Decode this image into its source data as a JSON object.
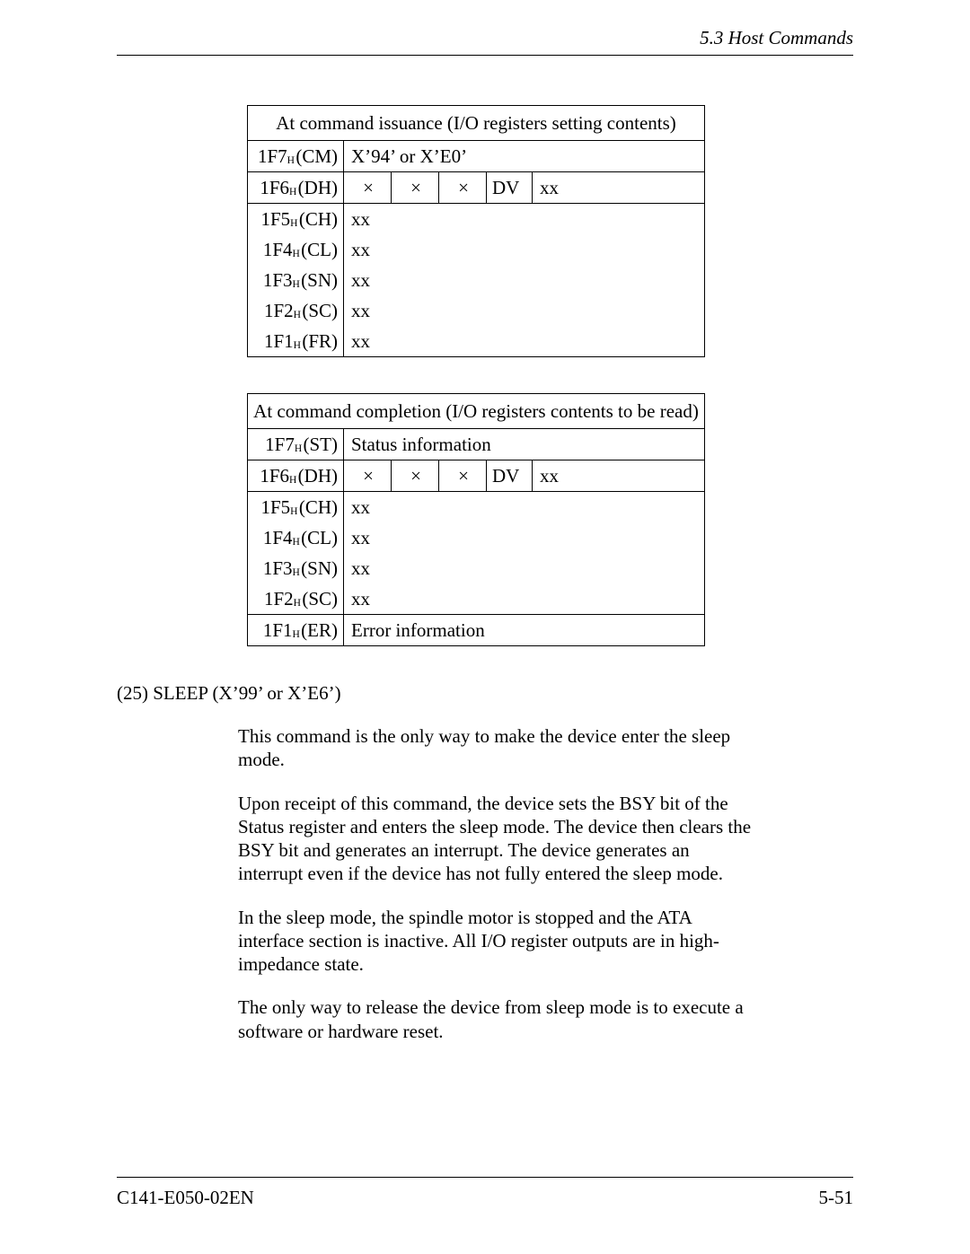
{
  "header": {
    "section": "5.3  Host Commands"
  },
  "tables": {
    "issuance": {
      "caption": "At command issuance (I/O registers setting contents)",
      "rows": [
        {
          "reg": "1F7",
          "sub": "H",
          "name": "CM",
          "full": "X’94’ or X’E0’"
        },
        {
          "reg": "1F6",
          "sub": "H",
          "name": "DH",
          "bits": [
            "×",
            "×",
            "×",
            "DV",
            "xx"
          ]
        },
        {
          "reg": "1F5",
          "sub": "H",
          "name": "CH",
          "full": "xx"
        },
        {
          "reg": "1F4",
          "sub": "H",
          "name": "CL",
          "full": "xx"
        },
        {
          "reg": "1F3",
          "sub": "H",
          "name": "SN",
          "full": "xx"
        },
        {
          "reg": "1F2",
          "sub": "H",
          "name": "SC",
          "full": "xx"
        },
        {
          "reg": "1F1",
          "sub": "H",
          "name": "FR",
          "full": "xx"
        }
      ]
    },
    "completion": {
      "caption": "At command completion (I/O registers contents to be read)",
      "rows": [
        {
          "reg": "1F7",
          "sub": "H",
          "name": "ST",
          "full": "Status information"
        },
        {
          "reg": "1F6",
          "sub": "H",
          "name": "DH",
          "bits": [
            "×",
            "×",
            "×",
            "DV",
            "xx"
          ]
        },
        {
          "reg": "1F5",
          "sub": "H",
          "name": "CH",
          "full": "xx"
        },
        {
          "reg": "1F4",
          "sub": "H",
          "name": "CL",
          "full": "xx"
        },
        {
          "reg": "1F3",
          "sub": "H",
          "name": "SN",
          "full": "xx"
        },
        {
          "reg": "1F2",
          "sub": "H",
          "name": "SC",
          "full": "xx"
        },
        {
          "reg": "1F1",
          "sub": "H",
          "name": "ER",
          "full": "Error information"
        }
      ]
    }
  },
  "section25": {
    "heading": "(25)  SLEEP (X’99’ or X’E6’)",
    "p1": "This command is the only way to make the device enter the sleep mode.",
    "p2": "Upon receipt of this command, the device sets the BSY bit of the Status register and enters the sleep mode.  The device then clears the BSY bit and generates an interrupt. The device generates an interrupt even if the device has not fully entered the sleep mode.",
    "p3": "In the sleep mode, the spindle motor is stopped and the ATA interface section is inactive.  All I/O register outputs are in high-impedance state.",
    "p4": "The only way to release the device from sleep mode is to execute a software or hardware reset."
  },
  "footer": {
    "doc": "C141-E050-02EN",
    "page": "5-51"
  }
}
